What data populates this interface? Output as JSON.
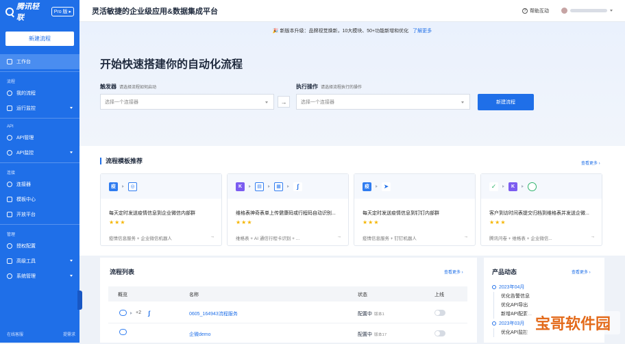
{
  "sidebar": {
    "logo_text": "腾讯轻联",
    "pro_badge": "Pro 版 ▸",
    "new_flow": "新建流程",
    "items": {
      "workbench": "工作台",
      "group_flow": "流程",
      "my_flows": "我的流程",
      "run_monitor": "运行监控",
      "group_api": "API",
      "api_manage": "API管理",
      "api_monitor": "API监控",
      "group_connect": "连接",
      "connectors": "连接器",
      "template_center": "模板中心",
      "open_platform": "开放平台",
      "group_manage": "管理",
      "auth_config": "授权配置",
      "advanced_tools": "高级工具",
      "system_manage": "系统管理"
    },
    "footer_service": "在线客服",
    "footer_feedback": "提需求"
  },
  "topbar": {
    "title": "灵活敏捷的企业级应用&数据集成平台",
    "help": "帮助互动"
  },
  "hero": {
    "announcement": "🎉 新版本升级：品牌视觉焕新，10大模块、50+功能新增和优化",
    "announcement_link": "了解更多",
    "title": "开始快速搭建你的自动化流程",
    "trigger_label": "触发器",
    "trigger_hint": "请选择流程如何启动",
    "trigger_placeholder": "选择一个连接器",
    "action_label": "执行操作",
    "action_hint": "请选择流程执行的操作",
    "action_placeholder": "选择一个连接器",
    "create_button": "新建流程"
  },
  "templates": {
    "title": "流程模板推荐",
    "see_more": "查看更多 ›",
    "cards": [
      {
        "desc": "每天定时发送疫情信息到企业微信内部群",
        "stars": "★★★",
        "foot": "疫情信息服务 + 企业微信机器人"
      },
      {
        "desc": "维格表神奇表单上传健康码或行程码自动识别...",
        "stars": "★★★",
        "foot": "维格表 + AI 通信行程卡识别 + ..."
      },
      {
        "desc": "每天定时发送疫情信息到钉钉内部群",
        "stars": "★★★",
        "foot": "疫情信息服务 + 钉钉机器人"
      },
      {
        "desc": "客户到访时间表提交归档到维格表并发送企微...",
        "stars": "★★★",
        "foot": "腾讯问卷 + 维格表 + 企业微信..."
      }
    ]
  },
  "flow_list": {
    "title": "流程列表",
    "see_more": "查看更多 ›",
    "columns": [
      "概览",
      "名称",
      "状态",
      "上线"
    ],
    "rows": [
      {
        "overview_extra": "+2",
        "name": "0605_164943流程服务",
        "status": "配置中",
        "version": "版本1"
      },
      {
        "overview_extra": "",
        "name": "企微demo",
        "status": "配置中",
        "version": "版本17"
      }
    ]
  },
  "news": {
    "title": "产品动态",
    "see_more": "查看更多 ›",
    "groups": [
      {
        "date": "2023年04月",
        "items": [
          "优化告警信息",
          "优化API导出",
          "新增API配置..."
        ]
      },
      {
        "date": "2023年03月",
        "items": [
          "优化API监控"
        ]
      }
    ]
  },
  "watermark": "宝哥软件园"
}
